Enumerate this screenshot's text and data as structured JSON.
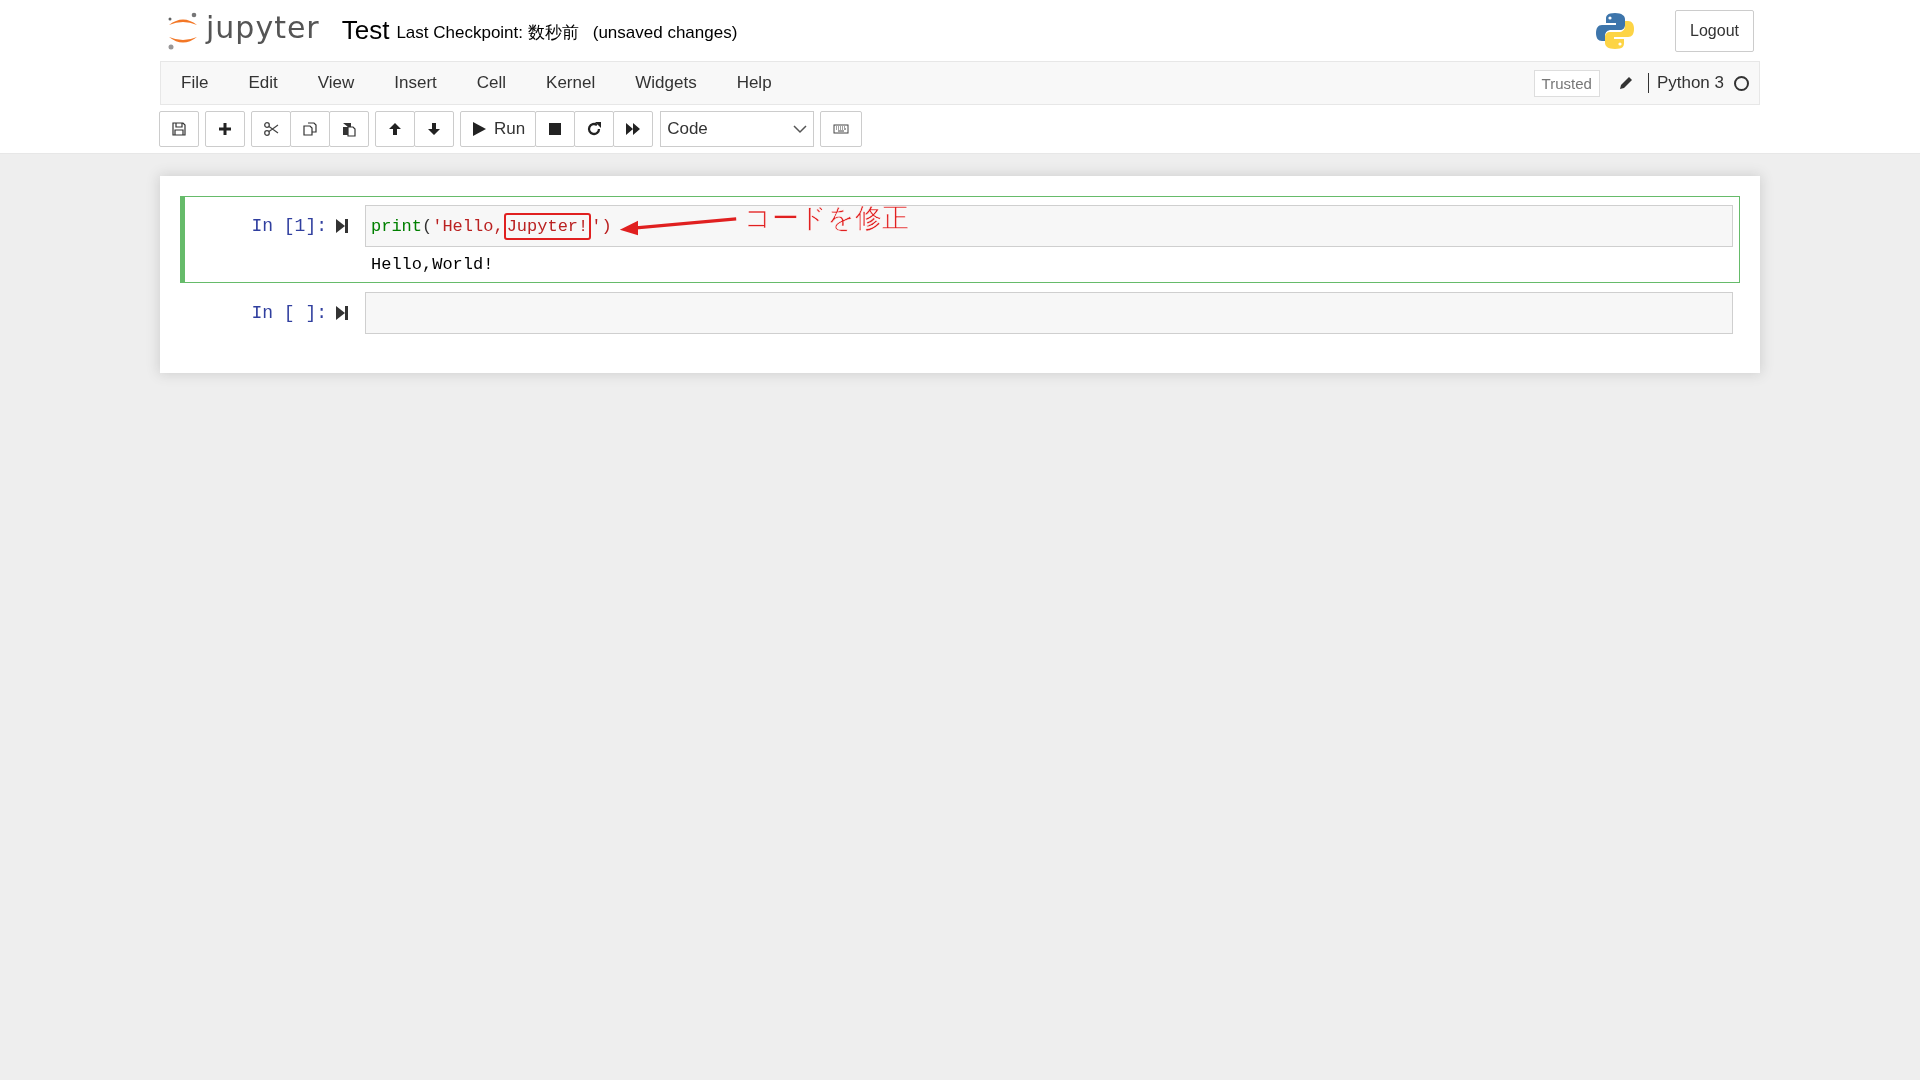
{
  "header": {
    "logo_text": "jupyter",
    "notebook_name": "Test",
    "checkpoint": "Last Checkpoint: 数秒前",
    "save_status": "(unsaved changes)",
    "logout": "Logout"
  },
  "menu": [
    "File",
    "Edit",
    "View",
    "Insert",
    "Cell",
    "Kernel",
    "Widgets",
    "Help"
  ],
  "menu_right": {
    "trusted": "Trusted",
    "kernel": "Python 3",
    "kernel_busy": false
  },
  "toolbar": [
    [
      {
        "kind": "save"
      }
    ],
    [
      {
        "kind": "add"
      }
    ],
    [
      {
        "kind": "cut"
      },
      {
        "kind": "copy"
      },
      {
        "kind": "paste"
      }
    ],
    [
      {
        "kind": "up"
      },
      {
        "kind": "down"
      }
    ],
    [
      {
        "kind": "run",
        "label": "Run"
      },
      {
        "kind": "stop"
      },
      {
        "kind": "restart"
      },
      {
        "kind": "fast-forward"
      }
    ],
    [
      {
        "kind": "cell-type",
        "label": "Code"
      }
    ],
    [
      {
        "kind": "keyboard"
      }
    ]
  ],
  "cells": [
    {
      "prompt": "In [1]:",
      "selected": true,
      "code": {
        "keyword": "print",
        "open": "(",
        "string": "'Hello,",
        "highlighted": "Jupyter!",
        "close": "')"
      },
      "output": "Hello,World!",
      "annotation": "コードを修正"
    },
    {
      "prompt": "In [ ]:",
      "selected": false
    }
  ]
}
